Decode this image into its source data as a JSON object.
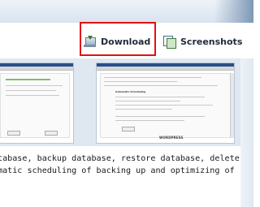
{
  "nav": {
    "download_label": "Download",
    "screenshots_label": "Screenshots",
    "download_icon": "download-icon",
    "screenshots_icon": "screenshots-icon"
  },
  "screenshots": {
    "right_heading": "Automatic Scheduling",
    "right_logo": "WORDPRESS"
  },
  "description": {
    "line1": "tabase, backup database, restore database, delete",
    "line2": "matic scheduling of backing up and optimizing of"
  },
  "colors": {
    "highlight": "#e11212",
    "panel": "#dfe8f1",
    "nav_text": "#1f2b3a"
  }
}
